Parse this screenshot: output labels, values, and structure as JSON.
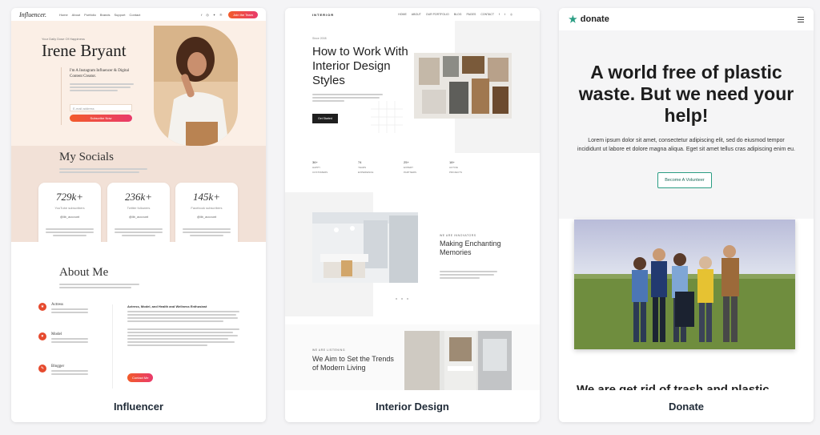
{
  "cards": [
    {
      "caption": "Influencer"
    },
    {
      "caption": "Interior Design"
    },
    {
      "caption": "Donate"
    }
  ],
  "influencer": {
    "logo": "Influencer.",
    "nav": [
      "Home",
      "About",
      "Portfolio",
      "Brands",
      "Support",
      "Contact"
    ],
    "social_icons": [
      "facebook-icon",
      "instagram-icon",
      "twitter-icon",
      "pinterest-icon"
    ],
    "cta": "Join the Team",
    "eyebrow": "Your Daily Dose Of Happiness",
    "name": "Irene Bryant",
    "subtitle": "I'm A Instagram Influencer & Digital Content Creator.",
    "email_placeholder": "E-mail address",
    "subscribe": "Subscribe Now",
    "socials_title": "My Socials",
    "stats": [
      {
        "value": "729k+",
        "label": "YouTube subscribers",
        "account": "@lib_account"
      },
      {
        "value": "236k+",
        "label": "Twitter followers",
        "account": "@lib_account"
      },
      {
        "value": "145k+",
        "label": "Facebook subscribers",
        "account": "@lib_account"
      }
    ],
    "about_title": "About Me",
    "roles": [
      "Actress",
      "Model",
      "Blogger"
    ],
    "about_text": "Actress, Model, and Health and Wellness Enthusiast",
    "contact_btn": "Contact Me"
  },
  "interior": {
    "logo": "INTERIOR",
    "nav": [
      "HOME",
      "ABOUT",
      "OUR PORTFOLIO",
      "BLOG",
      "PAGES",
      "CONTACT"
    ],
    "date": "Since 2008",
    "hero_title": "How to Work With Interior Design Styles",
    "hero_btn": "Get Started",
    "stats": [
      {
        "value": "36+",
        "label": "HAPPY CUSTOMERS"
      },
      {
        "value": "74",
        "label": "YEARS EXPERIENCE"
      },
      {
        "value": "25+",
        "label": "EXPERT PARTNERS"
      },
      {
        "value": "18+",
        "label": "ACTIVE PROJECTS"
      }
    ],
    "sec1_eyebrow": "WE ARE INNOVATORS",
    "sec1_title": "Making Enchanting Memories",
    "sec2_eyebrow": "WE ARE LISTENING",
    "sec2_title": "We Aim to Set the Trends of Modern Living"
  },
  "donate": {
    "logo": "donate",
    "title": "A world free of plastic waste. But we need your help!",
    "desc": "Lorem ipsum dolor sit amet, consectetur adipiscing elit, sed do eiusmod tempor incididunt ut labore et dolore magna aliqua. Eget sit amet tellus cras adipiscing enim eu.",
    "button": "Become A Volunteer",
    "cut_heading": "We are get rid of trash and plastic"
  },
  "colors": {
    "influencer_accent": "#e93a6b",
    "donate_accent": "#2a9d83",
    "interior_dark": "#1f1f1f"
  }
}
